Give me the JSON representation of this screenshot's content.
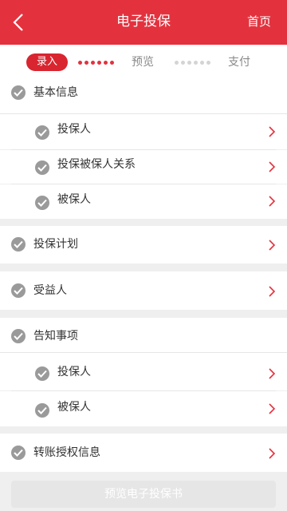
{
  "header": {
    "title": "电子投保",
    "home_label": "首页"
  },
  "steps": {
    "active": "录入",
    "preview": "预览",
    "pay": "支付"
  },
  "sections": {
    "basic_info": "基本信息",
    "policy_holder": "投保人",
    "relationship": "投保被保人关系",
    "insured": "被保人",
    "plan": "投保计划",
    "beneficiary": "受益人",
    "notice": "告知事项",
    "notice_holder": "投保人",
    "notice_insured": "被保人",
    "transfer_auth": "转账授权信息"
  },
  "footer": {
    "preview_button": "预览电子投保书"
  },
  "colors": {
    "brand": "#e3323e",
    "check": "#9a9a9a",
    "disabled": "#e6e6e6"
  }
}
